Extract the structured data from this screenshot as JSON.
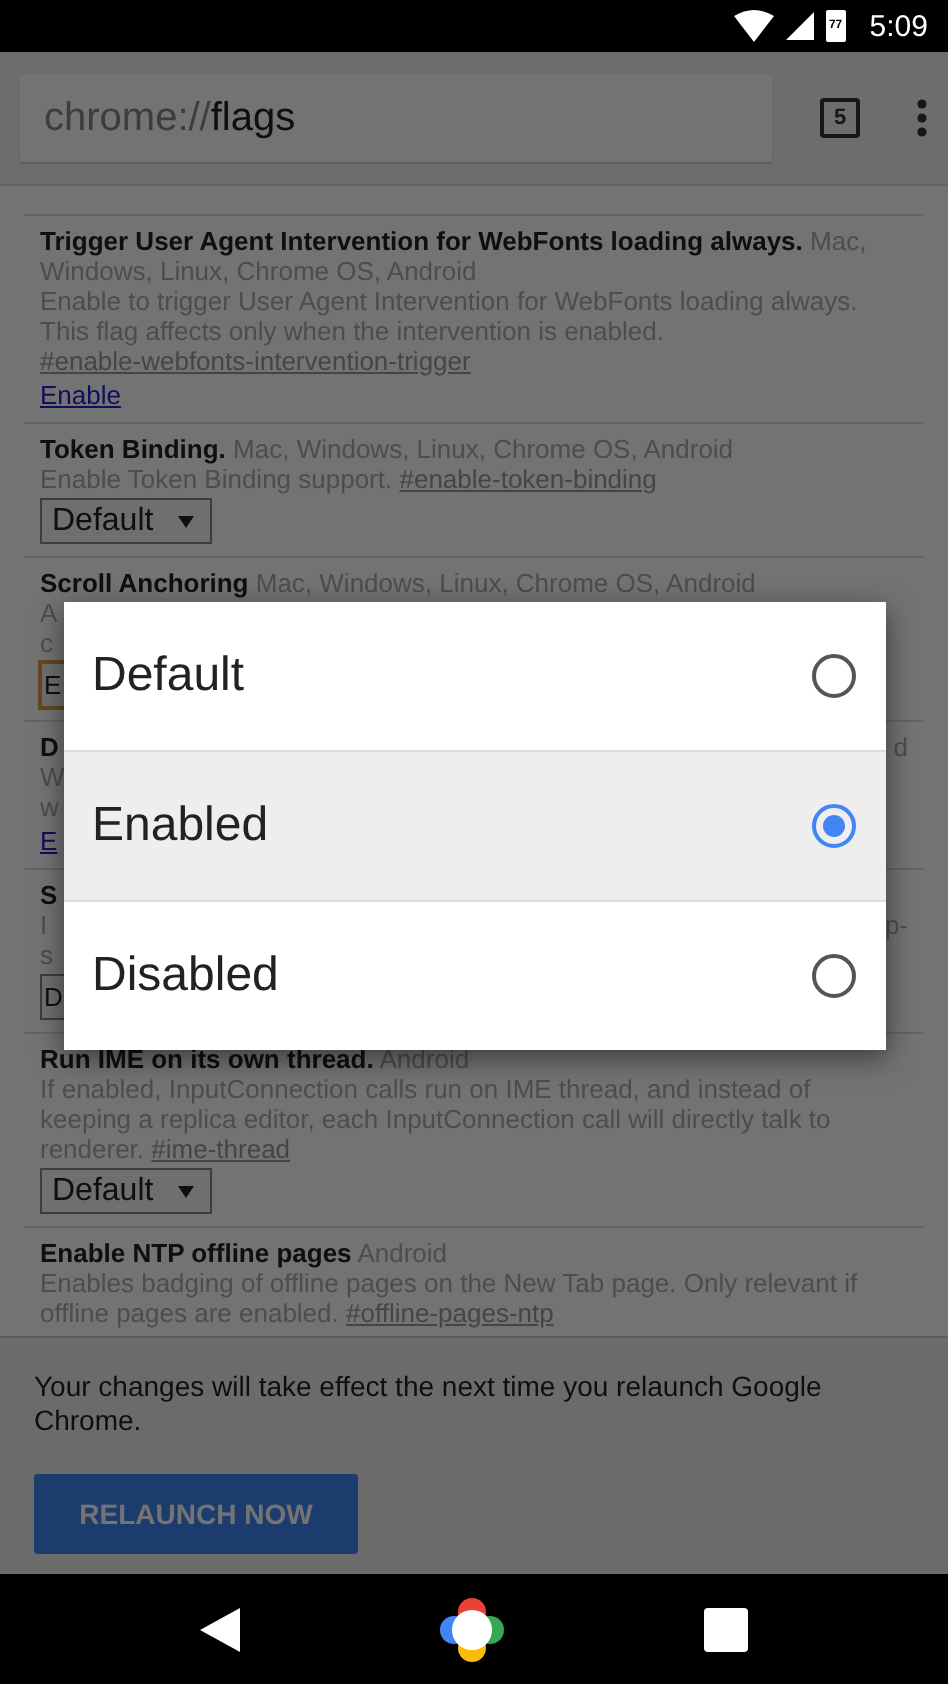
{
  "status_bar": {
    "battery": "77",
    "time": "5:09"
  },
  "toolbar": {
    "url": {
      "scheme": "chrome://",
      "path": "flags"
    },
    "tab_count": "5"
  },
  "flags": [
    {
      "kind": "full",
      "title": "Trigger User Agent Intervention for WebFonts loading always.",
      "platforms": "Mac, Windows, Linux, Chrome OS, Android",
      "description": "Enable to trigger User Agent Intervention for WebFonts loading always. This flag affects only when the intervention is enabled.",
      "anchor": "#enable-webfonts-intervention-trigger",
      "control": {
        "kind": "link",
        "label": "Enable"
      }
    },
    {
      "kind": "full",
      "title": "Token Binding.",
      "platforms": "Mac, Windows, Linux, Chrome OS, Android",
      "description": "Enable Token Binding support.",
      "anchor": "#enable-token-binding",
      "control": {
        "kind": "select",
        "label": "Default",
        "focused": false
      }
    },
    {
      "kind": "covered",
      "title": "Scroll Anchoring",
      "platforms": "Mac, Windows, Linux, Chrome OS, Android",
      "lines": [
        {
          "left": "A"
        },
        {
          "left": "c"
        }
      ],
      "control": {
        "kind": "select",
        "label": "E",
        "focused": true
      }
    },
    {
      "kind": "covered",
      "lines": [
        {
          "left": "D",
          "right": "d",
          "bold": true
        },
        {
          "left": "W",
          "bold": false
        },
        {
          "left": "w",
          "bold": false
        }
      ],
      "control": {
        "kind": "link",
        "label": "E"
      }
    },
    {
      "kind": "covered",
      "lines": [
        {
          "left": "S",
          "bold": true
        },
        {
          "left": "I",
          "right": "p-",
          "bold": false
        },
        {
          "left": "s",
          "bold": false
        }
      ],
      "control": {
        "kind": "select",
        "label": "D",
        "focused": false
      }
    },
    {
      "kind": "full",
      "title": "Run IME on its own thread.",
      "platforms": "Android",
      "description": "If enabled, InputConnection calls run on IME thread, and instead of keeping a replica editor, each InputConnection call will directly talk to renderer.",
      "anchor": "#ime-thread",
      "control": {
        "kind": "select",
        "label": "Default",
        "focused": false
      }
    },
    {
      "kind": "full",
      "title": "Enable NTP offline pages",
      "platforms": "Android",
      "description": "Enables badging of offline pages on the New Tab page. Only relevant if offline pages are enabled.",
      "anchor": "#offline-pages-ntp"
    }
  ],
  "relaunch": {
    "message": "Your changes will take effect the next time you relaunch Google Chrome.",
    "button": "RELAUNCH NOW"
  },
  "dialog": {
    "options": [
      {
        "label": "Default",
        "selected": false
      },
      {
        "label": "Enabled",
        "selected": true
      },
      {
        "label": "Disabled",
        "selected": false
      }
    ]
  }
}
